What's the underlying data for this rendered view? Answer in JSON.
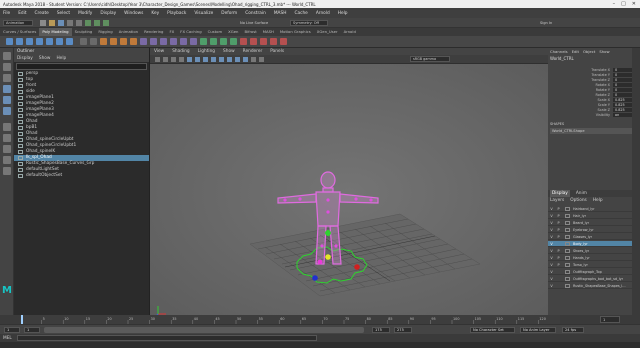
{
  "title_bar": {
    "text": "Autodesk Maya 2018 - Student Version: C:\\Users\\cidh\\Desktop\\Year 3\\Character_Design_Games\\Scenes\\Modelling\\Ohad_rigging_CTRL_3.mb* --- World_CTRL"
  },
  "menu": {
    "items": [
      "File",
      "Edit",
      "Create",
      "Select",
      "Modify",
      "Display",
      "Windows",
      "Key",
      "Playback",
      "Visualize",
      "Deform",
      "Constrain",
      "MASH",
      "Cache",
      "Arnold",
      "Help"
    ]
  },
  "status_line": {
    "mode": "Animation",
    "symmetry": "Symmetry: Off",
    "no_live_surface": "No Live Surface",
    "sign_in": "Sign In"
  },
  "shelf_tabs": [
    "Curves / Surfaces",
    "Poly Modeling",
    "Sculpting",
    "Rigging",
    "Animation",
    "Rendering",
    "FX",
    "FX Caching",
    "Custom",
    "XGen",
    "Bifrost",
    "MASH",
    "Motion Graphics",
    "XGen_User",
    "Arnold"
  ],
  "active_shelf": "Poly Modeling",
  "outliner": {
    "title": "Outliner",
    "menu": [
      "Display",
      "Show",
      "Help"
    ],
    "rows": [
      {
        "label": "persp"
      },
      {
        "label": "top"
      },
      {
        "label": "front"
      },
      {
        "label": "side"
      },
      {
        "label": "imagePlane1"
      },
      {
        "label": "imagePlane2"
      },
      {
        "label": "imagePlane3"
      },
      {
        "label": "imagePlane4"
      },
      {
        "label": "Ohad"
      },
      {
        "label": "bpB1"
      },
      {
        "label": "Ohad"
      },
      {
        "label": "Ohad_spineCircleUpbt"
      },
      {
        "label": "Ohad_spineCircleUpbt1"
      },
      {
        "label": "Ohad_spineIK"
      },
      {
        "label": "Ik_spl_Ohad"
      },
      {
        "label": "Rustic_ShapesBase_Curves_Grp"
      },
      {
        "label": "defaultLightSet"
      },
      {
        "label": "defaultObjectSet"
      }
    ],
    "selected_index": 14
  },
  "viewport": {
    "menu": [
      "View",
      "Shading",
      "Lighting",
      "Show",
      "Renderer",
      "Panels"
    ],
    "colorspace": "sRGB gamma",
    "camera_label": "3D PoseDown : persp"
  },
  "channel_box": {
    "tabs": [
      "Channels",
      "Edit",
      "Object",
      "Show"
    ],
    "node": "World_CTRL",
    "attributes": [
      {
        "name": "Translate X",
        "value": "0"
      },
      {
        "name": "Translate Y",
        "value": "0"
      },
      {
        "name": "Translate Z",
        "value": "0"
      },
      {
        "name": "Rotate X",
        "value": "0"
      },
      {
        "name": "Rotate Y",
        "value": "0"
      },
      {
        "name": "Rotate Z",
        "value": "0"
      },
      {
        "name": "Scale X",
        "value": "0.825"
      },
      {
        "name": "Scale Y",
        "value": "0.825"
      },
      {
        "name": "Scale Z",
        "value": "0.825"
      },
      {
        "name": "Visibility",
        "value": "on"
      }
    ],
    "shapes_label": "SHAPES",
    "shape_name": "World_CTRLShape"
  },
  "layers": {
    "tabs": [
      "Display",
      "Anim"
    ],
    "menu": [
      "Layers",
      "Options",
      "Help"
    ],
    "rows": [
      {
        "v": "V",
        "p": "P",
        "name": "Hairband_lyr"
      },
      {
        "v": "V",
        "p": "P",
        "name": "Hair_lyr"
      },
      {
        "v": "V",
        "p": "P",
        "name": "Beard_lyr"
      },
      {
        "v": "V",
        "p": "P",
        "name": "Eyebrow_lyr"
      },
      {
        "v": "V",
        "p": "P",
        "name": "Glasses_lyr"
      },
      {
        "v": "V",
        "p": "",
        "name": "Body_lyr"
      },
      {
        "v": "V",
        "p": "P",
        "name": "Shoes_lyr"
      },
      {
        "v": "V",
        "p": "P",
        "name": "Hands_lyr"
      },
      {
        "v": "V",
        "p": "P",
        "name": "Torso_lyr"
      },
      {
        "v": "V",
        "p": "",
        "name": "Outfitsgraph_Top"
      },
      {
        "v": "V",
        "p": "",
        "name": "Outfitsgraphs_bod_bot_sd_lyr"
      },
      {
        "v": "V",
        "p": "",
        "name": "Rustic_ShapesBase_Shapes_l..."
      }
    ],
    "selected_index": 5
  },
  "time": {
    "ticks": [
      "5",
      "10",
      "15",
      "20",
      "25",
      "30",
      "35",
      "40",
      "45",
      "50",
      "55",
      "60",
      "65",
      "70",
      "75",
      "80",
      "85",
      "90",
      "95",
      "100",
      "105",
      "110",
      "115",
      "120"
    ],
    "current": "1",
    "range_start": "1",
    "range_end": "120",
    "anim_end": "175",
    "anim_end2": "275",
    "character_set": "No Character Set",
    "anim_layer": "No Anim Layer",
    "fps": "24 fps"
  },
  "command_line": {
    "label": "MEL"
  }
}
